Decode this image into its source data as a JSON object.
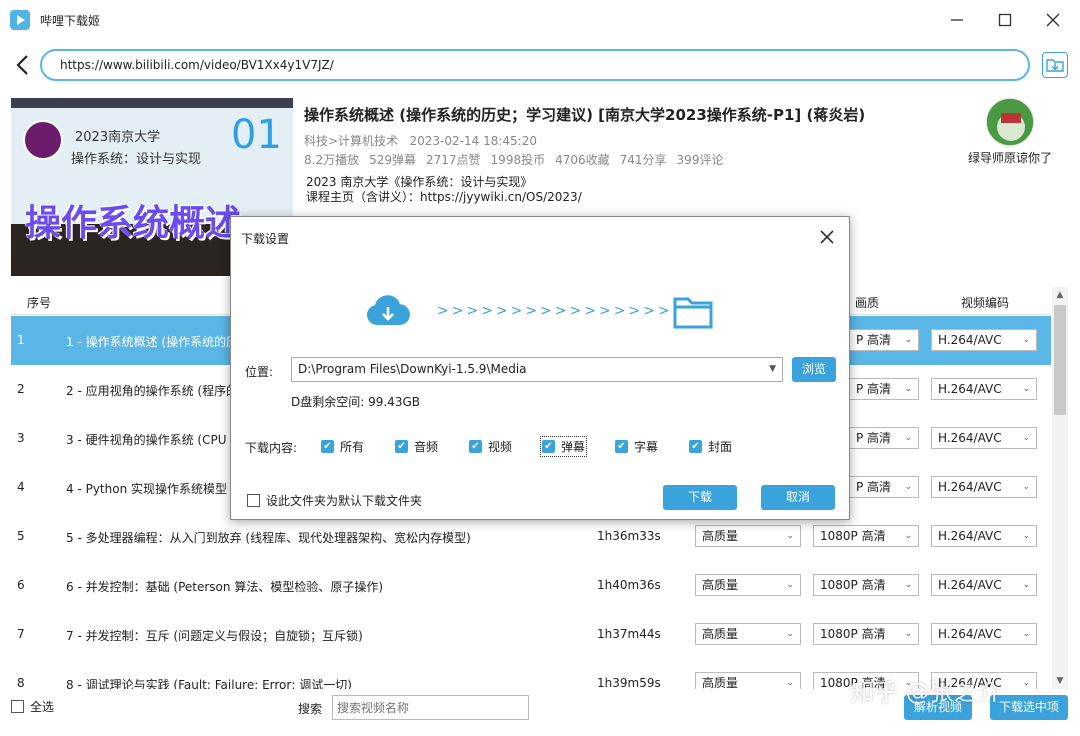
{
  "window": {
    "title": "哔哩下载姬",
    "colors": {
      "accent": "#3aa3dc",
      "selected_row": "#5ab6e6"
    }
  },
  "address": {
    "url": "https://www.bilibili.com/video/BV1Xx4y1V7JZ/"
  },
  "video": {
    "thumbnail_text": {
      "line1": "2023南京大学",
      "line2": "操作系统：设计与实现",
      "number": "01",
      "big": "操作系统概述"
    },
    "title": "操作系统概述 (操作系统的历史；学习建议) [南京大学2023操作系统-P1] (蒋炎岩)",
    "category": "科技>计算机技术",
    "date": "2023-02-14 18:45:20",
    "stats": [
      "8.2万播放",
      "529弹幕",
      "2717点赞",
      "1998投币",
      "4706收藏",
      "741分享",
      "399评论"
    ],
    "desc_line1": "2023 南京大学《操作系统：设计与实现》",
    "desc_line2": "课程主页（含讲义）：https://jyywiki.cn/OS/2023/",
    "uploader": "绿导师原谅你了"
  },
  "table": {
    "headers": {
      "index": "序号",
      "quality": "画质",
      "codec": "视频编码"
    },
    "rows": [
      {
        "index": "1",
        "name": "1 - 操作系统概述 (操作系统的历",
        "duration": "",
        "audio": "",
        "quality": "P 高清",
        "codec": "H.264/AVC"
      },
      {
        "index": "2",
        "name": "2 - 应用视角的操作系统 (程序的",
        "duration": "",
        "audio": "",
        "quality": "P 高清",
        "codec": "H.264/AVC"
      },
      {
        "index": "3",
        "name": "3 - 硬件视角的操作系统 (CPU R",
        "duration": "",
        "audio": "",
        "quality": "P 高清",
        "codec": "H.264/AVC"
      },
      {
        "index": "4",
        "name": "4 - Python 实现操作系统模型",
        "duration": "",
        "audio": "",
        "quality": "P 高清",
        "codec": "H.264/AVC"
      },
      {
        "index": "5",
        "name": "5 - 多处理器编程：从入门到放弃 (线程库、现代处理器架构、宽松内存模型)",
        "duration": "1h36m33s",
        "audio": "高质量",
        "quality": "1080P 高清",
        "codec": "H.264/AVC"
      },
      {
        "index": "6",
        "name": "6 - 并发控制：基础 (Peterson 算法、模型检验、原子操作)",
        "duration": "1h40m36s",
        "audio": "高质量",
        "quality": "1080P 高清",
        "codec": "H.264/AVC"
      },
      {
        "index": "7",
        "name": "7 - 并发控制：互斥 (问题定义与假设；自旋锁；互斥锁)",
        "duration": "1h37m44s",
        "audio": "高质量",
        "quality": "1080P 高清",
        "codec": "H.264/AVC"
      },
      {
        "index": "8",
        "name": "8 - 调试理论与实践 (Fault; Failure; Error; 调试一切)",
        "duration": "1h39m59s",
        "audio": "高质量",
        "quality": "1080P 高清",
        "codec": "H.264/AVC"
      }
    ]
  },
  "bottom": {
    "select_all": "全选",
    "search_label": "搜索",
    "search_placeholder": "搜索视频名称",
    "parse_button": "解析视频",
    "download_selected": "下载选中项",
    "watermark": "知乎 @张之介"
  },
  "dialog": {
    "title": "下载设置",
    "arrows": ">>>>>>>>>>>>>>>>",
    "position_label": "位置:",
    "path": "D:\\Program Files\\DownKyi-1.5.9\\Media",
    "browse": "浏览",
    "free_space": "D盘剩余空间: 99.43GB",
    "content_label": "下载内容:",
    "options": {
      "all": "所有",
      "audio": "音频",
      "video": "视频",
      "danmaku": "弹幕",
      "subtitle": "字幕",
      "cover": "封面"
    },
    "set_default": "设此文件夹为默认下载文件夹",
    "download": "下载",
    "cancel": "取消"
  }
}
